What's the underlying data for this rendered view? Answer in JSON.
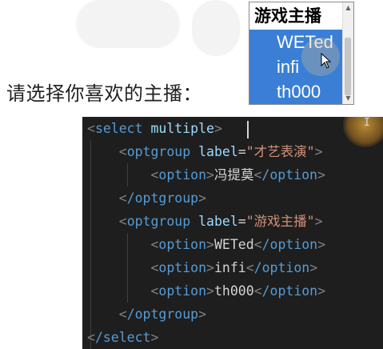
{
  "prompt": {
    "label": "请选择你喜欢的主播："
  },
  "select": {
    "group_label": "游戏主播",
    "options": [
      "WETed",
      "infi",
      "th000"
    ]
  },
  "colors": {
    "selected_bg": "#3a7fd5",
    "editor_bg": "#1e1e1e",
    "tag": "#569cd6",
    "attr": "#9cdcfe",
    "string": "#ce9178",
    "bracket": "#808080"
  },
  "code": {
    "l1": {
      "tag": "select",
      "attr": "multiple"
    },
    "l2": {
      "tag": "optgroup",
      "attr": "label",
      "value": "\"才艺表演\""
    },
    "l3": {
      "tag": "option",
      "text": "冯提莫",
      "close": "/option"
    },
    "l4": {
      "close": "/optgroup"
    },
    "l5": {
      "tag": "optgroup",
      "attr": "label",
      "value": "\"游戏主播\""
    },
    "l6": {
      "tag": "option",
      "text": "WETed",
      "close": "/option"
    },
    "l7": {
      "tag": "option",
      "text": "infi",
      "close": "/option"
    },
    "l8": {
      "tag": "option",
      "text": "th000",
      "close": "/option"
    },
    "l9": {
      "close": "/optgroup"
    },
    "l10": {
      "close": "/select"
    }
  },
  "icons": {
    "cursor": "arrow-cursor-icon",
    "ibeam": "text-cursor-icon"
  }
}
